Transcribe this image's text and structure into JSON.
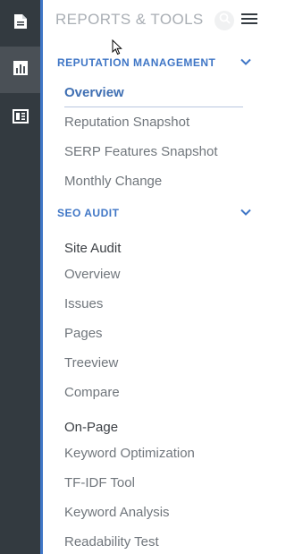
{
  "rail": {
    "items": [
      {
        "icon": "document-icon",
        "active": false
      },
      {
        "icon": "bar-chart-icon",
        "active": true
      },
      {
        "icon": "table-layout-icon",
        "active": false
      }
    ]
  },
  "panel": {
    "title": "REPORTS & TOOLS"
  },
  "sections": {
    "reputation": {
      "label": "REPUTATION MANAGEMENT",
      "items": [
        "Overview",
        "Reputation Snapshot",
        "SERP Features Snapshot",
        "Monthly Change"
      ]
    },
    "seo": {
      "label": "SEO AUDIT",
      "site_audit": {
        "label": "Site Audit",
        "items": [
          "Overview",
          "Issues",
          "Pages",
          "Treeview",
          "Compare"
        ]
      },
      "on_page": {
        "label": "On-Page",
        "items": [
          "Keyword Optimization",
          "TF-IDF Tool",
          "Keyword Analysis",
          "Readability Test"
        ]
      }
    }
  },
  "colors": {
    "rail_bg": "#333a40",
    "rail_active": "#4a5056",
    "accent": "#3f76c6",
    "item_text": "#70767c",
    "subhead_text": "#3b3f44"
  }
}
